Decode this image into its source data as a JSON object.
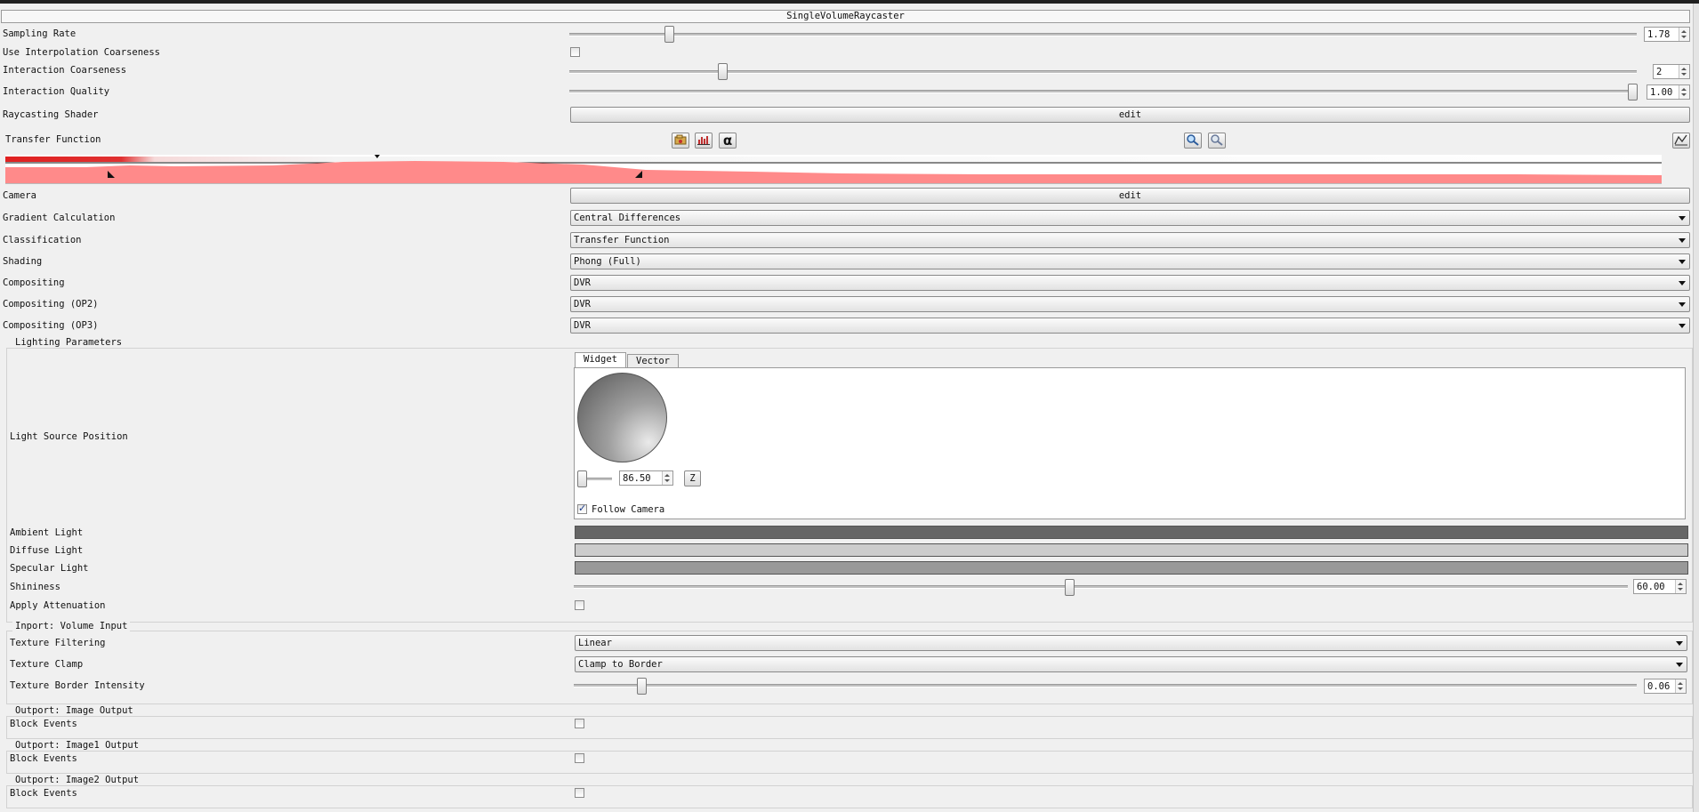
{
  "window": {
    "title": "SingleVolumeRaycaster"
  },
  "properties": {
    "sampling_rate": {
      "label": "Sampling Rate",
      "value": "1.78",
      "level": 0.09
    },
    "use_interpolation_coarseness": {
      "label": "Use Interpolation Coarseness",
      "checked": false
    },
    "interaction_coarseness": {
      "label": "Interaction Coarseness",
      "value": "2",
      "level": 0.14
    },
    "interaction_quality": {
      "label": "Interaction Quality",
      "value": "1.00",
      "level": 1.0
    },
    "raycasting_shader": {
      "label": "Raycasting Shader",
      "button": "edit"
    },
    "transfer_function": {
      "label": "Transfer Function"
    },
    "camera": {
      "label": "Camera",
      "button": "edit"
    },
    "gradient_calculation": {
      "label": "Gradient Calculation",
      "value": "Central Differences"
    },
    "classification": {
      "label": "Classification",
      "value": "Transfer Function"
    },
    "shading": {
      "label": "Shading",
      "value": "Phong (Full)"
    },
    "compositing": {
      "label": "Compositing",
      "value": "DVR"
    },
    "compositing_op2": {
      "label": "Compositing (OP2)",
      "value": "DVR"
    },
    "compositing_op3": {
      "label": "Compositing (OP3)",
      "value": "DVR"
    }
  },
  "transfer_function_toolbar": {
    "icons": [
      "load-icon",
      "save-histogram-icon",
      "alpha-icon",
      "zoom-in-icon",
      "zoom-out-icon",
      "curve-editor-icon"
    ],
    "alpha_glyph": "α"
  },
  "lighting": {
    "group_title": "Lighting Parameters",
    "light_source_position": {
      "label": "Light Source Position",
      "tabs": [
        "Widget",
        "Vector"
      ],
      "active_tab": "Widget",
      "distance_value": "86.50",
      "axis_button": "Z",
      "follow_camera": {
        "label": "Follow Camera",
        "checked": true
      }
    },
    "ambient_light": {
      "label": "Ambient Light",
      "color": "#666666"
    },
    "diffuse_light": {
      "label": "Diffuse Light",
      "color": "#cccccc"
    },
    "specular_light": {
      "label": "Specular Light",
      "color": "#999999"
    },
    "shininess": {
      "label": "Shininess",
      "value": "60.00",
      "level": 0.47
    },
    "apply_attenuation": {
      "label": "Apply Attenuation",
      "checked": false
    }
  },
  "inport_volume": {
    "group_title": "Inport: Volume Input",
    "texture_filtering": {
      "label": "Texture Filtering",
      "value": "Linear"
    },
    "texture_clamp": {
      "label": "Texture Clamp",
      "value": "Clamp to Border"
    },
    "texture_border_intensity": {
      "label": "Texture Border Intensity",
      "value": "0.06",
      "level": 0.06
    }
  },
  "outports": [
    {
      "group_title": "Outport: Image Output",
      "label": "Block Events",
      "checked": false
    },
    {
      "group_title": "Outport: Image1 Output",
      "label": "Block Events",
      "checked": false
    },
    {
      "group_title": "Outport: Image2 Output",
      "label": "Block Events",
      "checked": false
    }
  ],
  "colors": {
    "tf_red": "#e02020",
    "tf_pink": "#ff8a8a",
    "window_bg": "#f0f0f0"
  }
}
